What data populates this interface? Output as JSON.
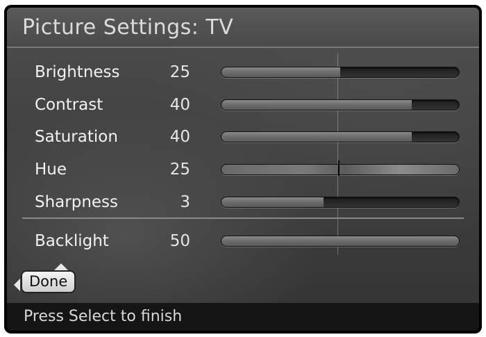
{
  "window": {
    "title": "Picture Settings: TV"
  },
  "settings": [
    {
      "label": "Brightness",
      "value": "25",
      "level": 0.5
    },
    {
      "label": "Contrast",
      "value": "40",
      "level": 0.8
    },
    {
      "label": "Saturation",
      "value": "40",
      "level": 0.8
    },
    {
      "label": "Hue",
      "value": "25",
      "level": 0.5
    },
    {
      "label": "Sharpness",
      "value": "3",
      "level": 0.43
    },
    {
      "label": "Backlight",
      "value": "50",
      "level": 1.0
    }
  ],
  "done_button": {
    "label": "Done"
  },
  "status": {
    "text": "Press Select to finish"
  },
  "colors": {
    "panel": "#3f3f3f",
    "fill": "#7a7a7a",
    "track": "#262626",
    "status_bg": "#151515"
  },
  "icons": {
    "up": "arrow-up-icon",
    "left": "arrow-left-icon"
  }
}
